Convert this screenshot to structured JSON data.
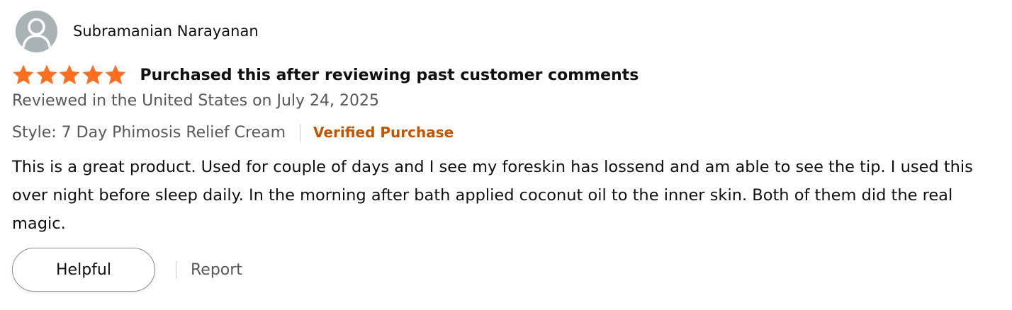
{
  "review": {
    "profile": {
      "name": "Subramanian Narayanan",
      "avatar_icon": "default-user-avatar-icon"
    },
    "rating": {
      "stars": 5,
      "out_of": 5,
      "star_icon": "star-icon",
      "star_color": "#ff6f1f"
    },
    "title": "Purchased this after reviewing past customer comments",
    "date_line": "Reviewed in the United States on July 24, 2025",
    "style_line": "Style: 7 Day Phimosis Relief Cream",
    "verified_label": "Verified Purchase",
    "verified_color": "#c45500",
    "body": "This is a great product. Used for couple of days and I see my foreskin has lossend and am able to see the tip. I used this over night before sleep daily. In the morning after bath applied coconut oil to the inner skin. Both of them did the real magic.",
    "actions": {
      "helpful_label": "Helpful",
      "report_label": "Report"
    }
  }
}
